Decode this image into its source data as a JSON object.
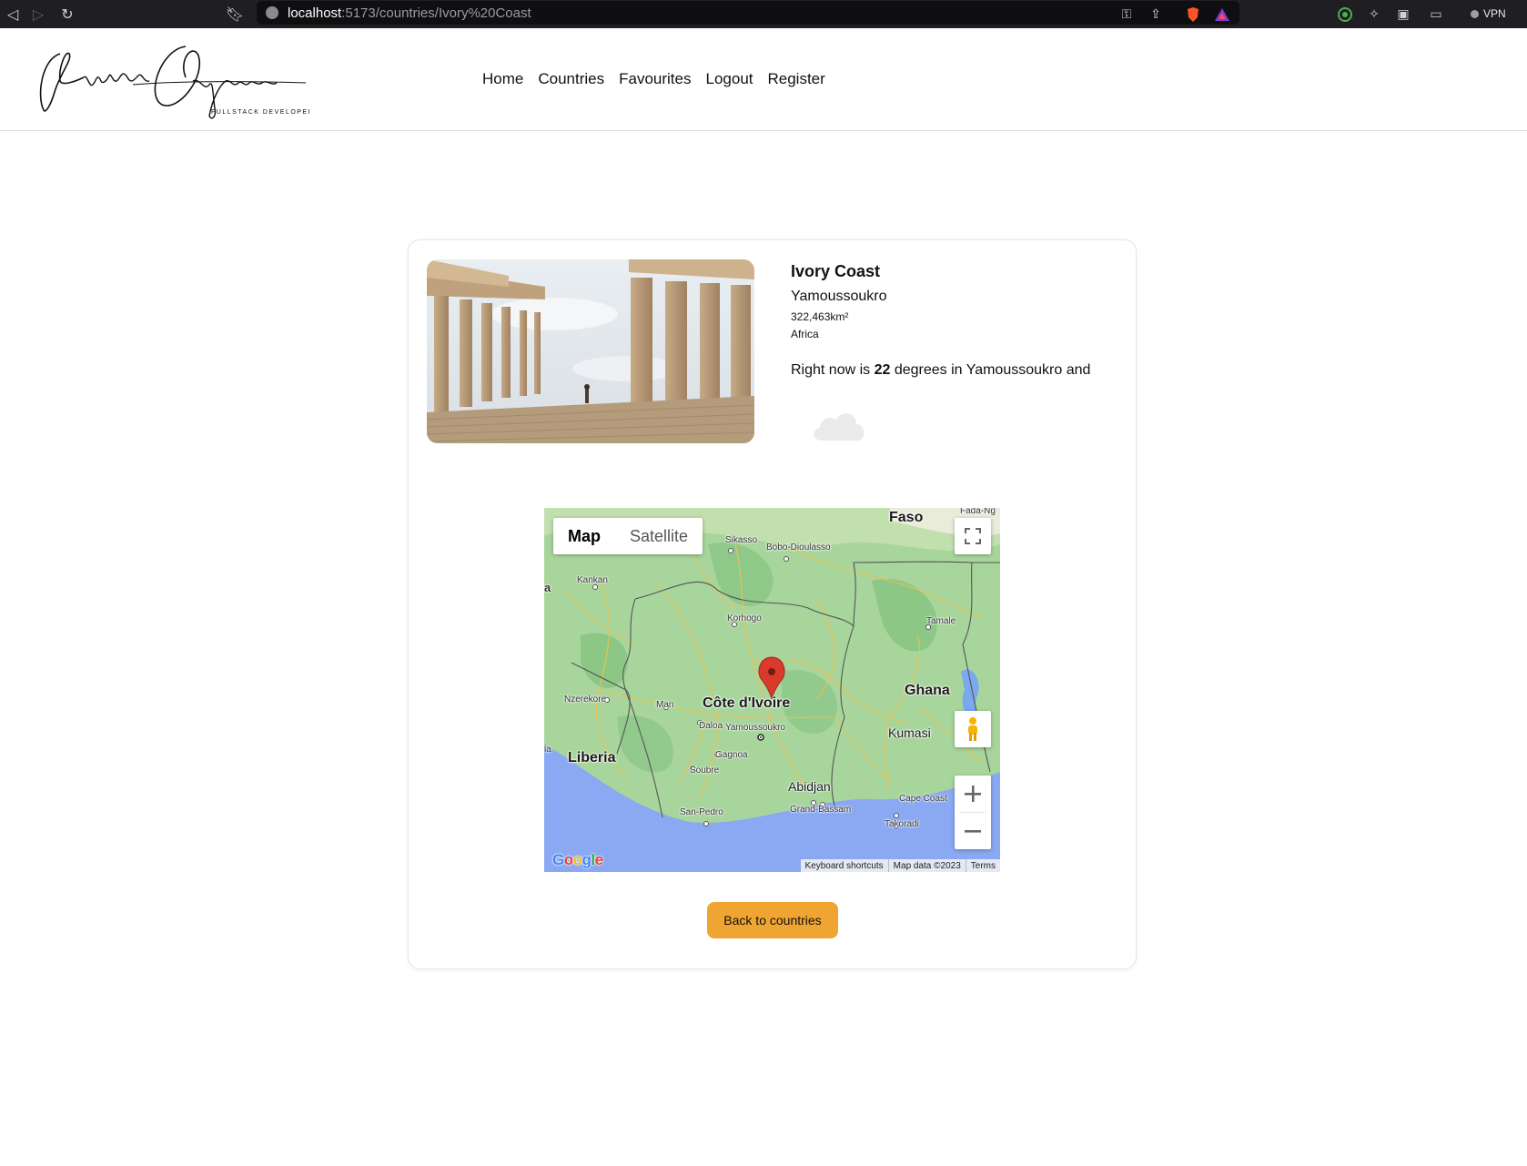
{
  "browser": {
    "url_host": "localhost",
    "url_path": ":5173/countries/Ivory%20Coast",
    "vpn_label": "VPN"
  },
  "header": {
    "logo_name": "Enitan Odupitan",
    "logo_tagline": "FULLSTACK DEVELOPER",
    "nav": [
      "Home",
      "Countries",
      "Favourites",
      "Logout",
      "Register"
    ]
  },
  "country": {
    "name": "Ivory Coast",
    "capital": "Yamoussoukro",
    "area": "322,463km²",
    "region": "Africa",
    "weather_prefix": "Right now is ",
    "temperature": "22",
    "weather_suffix": " degrees in Yamoussoukro and",
    "weather_icon": "cloud-icon"
  },
  "map": {
    "type_options": [
      "Map",
      "Satellite"
    ],
    "active_type": "Map",
    "labels": {
      "faso": "Faso",
      "fada": "Fada-Ng",
      "sikasso": "Sikasso",
      "bobo": "Bobo-Dioulasso",
      "kankan": "Kankan",
      "korhogo": "Korhogo",
      "tamale": "Tamale",
      "nzerekore": "Nzerekore",
      "man": "Man",
      "cote": "Côte d'Ivoire",
      "ghana": "Ghana",
      "daloa": "Daloa",
      "yamoussoukro": "Yamoussoukro",
      "kumasi": "Kumasi",
      "liberia": "Liberia",
      "gagnoa": "Gagnoa",
      "soubre": "Soubre",
      "abidjan": "Abidjan",
      "capecoast": "Cape Coast",
      "grandbassam": "Grand-Bassam",
      "sanpedro": "San-Pedro",
      "takoradi": "Takoradi",
      "edge_a": "a",
      "edge_ia": "ia"
    },
    "footer": [
      "Keyboard shortcuts",
      "Map data ©2023",
      "Terms"
    ],
    "google": "Google"
  },
  "actions": {
    "back_label": "Back to countries"
  }
}
